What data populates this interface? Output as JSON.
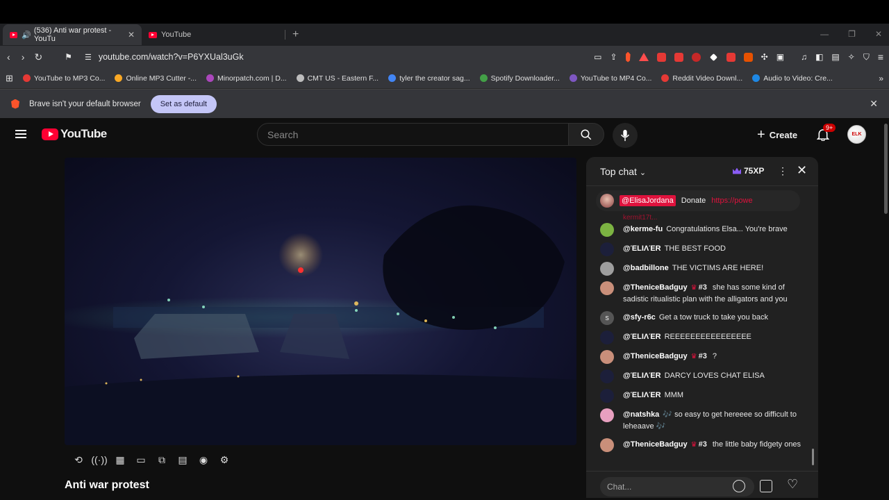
{
  "browser": {
    "tabs": [
      {
        "label": "(536) Anti war protest - YouTu",
        "active": true
      },
      {
        "label": "YouTube",
        "active": false
      }
    ],
    "new_tab": "+",
    "url": "youtube.com/watch?v=P6YXUal3uGk",
    "ext_badge": "9+",
    "bookmarks": [
      {
        "label": "YouTube to MP3 Co...",
        "color": "#e53935"
      },
      {
        "label": "Online MP3 Cutter -...",
        "color": "#f9a825"
      },
      {
        "label": "Minorpatch.com | D...",
        "color": "#ab47bc"
      },
      {
        "label": "CMT US - Eastern F...",
        "color": "#bdbdbd"
      },
      {
        "label": "tyler the creator sag...",
        "color": "#4285f4"
      },
      {
        "label": "Spotify Downloader...",
        "color": "#43a047"
      },
      {
        "label": "YouTube to MP4 Co...",
        "color": "#7e57c2"
      },
      {
        "label": "Reddit Video Downl...",
        "color": "#e53935"
      },
      {
        "label": "Audio to Video: Cre...",
        "color": "#1e88e5"
      }
    ],
    "infobar": {
      "message": "Brave isn't your default browser",
      "button": "Set as default"
    }
  },
  "youtube": {
    "logo_text": "YouTube",
    "search_placeholder": "Search",
    "create_label": "Create",
    "notif_badge": "9+",
    "avatar_text": "ELK",
    "video_title": "Anti war protest"
  },
  "chat": {
    "mode": "Top chat",
    "xp": "75XP",
    "pinned": {
      "user": "@ElisaJordana",
      "text": "Donate",
      "link": "https://powe"
    },
    "faded_user": "kermit17t...",
    "input_placeholder": "Chat...",
    "messages": [
      {
        "user": "@kerme-fu",
        "text": "Congratulations Elsa... You're brave",
        "level": "",
        "avatar_color": "#7cb342",
        "avatar_text": ""
      },
      {
        "user": "@ΈLIΛΈR",
        "text": "THE BEST FOOD",
        "level": "",
        "avatar_color": "#1c1f3a",
        "avatar_text": ""
      },
      {
        "user": "@badbillone",
        "text": "THE VICTIMS ARE HERE!",
        "level": "",
        "avatar_color": "#9e9e9e",
        "avatar_text": ""
      },
      {
        "user": "@TheniceBadguy",
        "text": "she has some kind of sadistic ritualistic plan with the alligators and you",
        "level": "#3",
        "avatar_color": "#c98f7a",
        "avatar_text": ""
      },
      {
        "user": "@sfy-r6c",
        "text": "Get a tow truck to take you back",
        "level": "",
        "avatar_color": "#555555",
        "avatar_text": "S"
      },
      {
        "user": "@ΈLIΛΈR",
        "text": "REEEEEEEEEEEEEEEE",
        "level": "",
        "avatar_color": "#1c1f3a",
        "avatar_text": ""
      },
      {
        "user": "@TheniceBadguy",
        "text": "?",
        "level": "#3",
        "avatar_color": "#c98f7a",
        "avatar_text": ""
      },
      {
        "user": "@ΈLIΛΈR",
        "text": "DARCY LOVES CHAT ELISA",
        "level": "",
        "avatar_color": "#1c1f3a",
        "avatar_text": ""
      },
      {
        "user": "@ΈLIΛΈR",
        "text": "MMM",
        "level": "",
        "avatar_color": "#1c1f3a",
        "avatar_text": ""
      },
      {
        "user": "@natshka",
        "text": "🎶 so easy to get hereeee so difficult to leheaave 🎶",
        "level": "",
        "avatar_color": "#e8a0c0",
        "avatar_text": ""
      },
      {
        "user": "@TheniceBadguy",
        "text": "the little baby fidgety ones",
        "level": "#3",
        "avatar_color": "#c98f7a",
        "avatar_text": ""
      }
    ]
  }
}
